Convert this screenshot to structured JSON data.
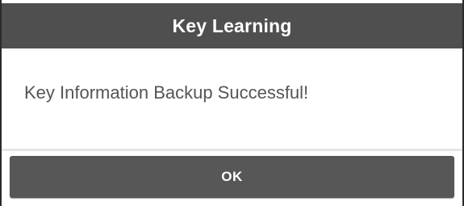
{
  "dialog": {
    "title": "Key Learning",
    "message": "Key Information Backup Successful!",
    "ok_label": "OK"
  },
  "colors": {
    "title_bar": "#4f4f4f",
    "button": "#575757",
    "message_text": "#555555",
    "title_text": "#ffffff"
  }
}
